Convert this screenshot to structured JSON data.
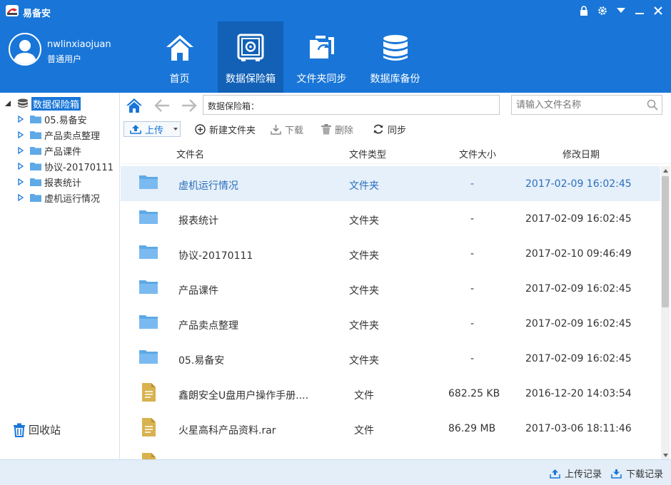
{
  "app": {
    "title": "易备安"
  },
  "user": {
    "name": "nwlinxiaojuan",
    "role": "普通用户"
  },
  "nav": [
    {
      "label": "首页",
      "icon": "home-icon"
    },
    {
      "label": "数据保险箱",
      "icon": "safe-icon",
      "active": true
    },
    {
      "label": "文件夹同步",
      "icon": "folder-sync-icon"
    },
    {
      "label": "数据库备份",
      "icon": "database-icon"
    }
  ],
  "tree": {
    "root": "数据保险箱",
    "children": [
      "05.易备安",
      "产品卖点整理",
      "产品课件",
      "协议-20170111",
      "报表统计",
      "虚机运行情况"
    ]
  },
  "recycle_label": "回收站",
  "address": {
    "path": "数据保险箱：",
    "search_placeholder": "请输入文件名称"
  },
  "toolbar": {
    "upload": "上传",
    "new_folder": "新建文件夹",
    "download": "下载",
    "delete": "删除",
    "sync": "同步"
  },
  "columns": {
    "name": "文件名",
    "type": "文件类型",
    "size": "文件大小",
    "date": "修改日期"
  },
  "files": [
    {
      "name": "虚机运行情况",
      "type": "文件夹",
      "size": "-",
      "date": "2017-02-09 16:02:45",
      "kind": "folder"
    },
    {
      "name": "报表统计",
      "type": "文件夹",
      "size": "-",
      "date": "2017-02-09 16:02:45",
      "kind": "folder"
    },
    {
      "name": "协议-20170111",
      "type": "文件夹",
      "size": "-",
      "date": "2017-02-10 09:46:49",
      "kind": "folder"
    },
    {
      "name": "产品课件",
      "type": "文件夹",
      "size": "-",
      "date": "2017-02-09 16:02:45",
      "kind": "folder"
    },
    {
      "name": "产品卖点整理",
      "type": "文件夹",
      "size": "-",
      "date": "2017-02-09 16:02:45",
      "kind": "folder"
    },
    {
      "name": "05.易备安",
      "type": "文件夹",
      "size": "-",
      "date": "2017-02-09 16:02:45",
      "kind": "folder"
    },
    {
      "name": "鑫朗安全U盘用户操作手册....",
      "type": "文件",
      "size": "682.25 KB",
      "date": "2016-12-20 14:03:54",
      "kind": "file"
    },
    {
      "name": "火星高科产品资料.rar",
      "type": "文件",
      "size": "86.29 MB",
      "date": "2017-03-06 18:11:46",
      "kind": "file"
    },
    {
      "name": "",
      "type": "",
      "size": "",
      "date": "",
      "kind": "file"
    }
  ],
  "footer": {
    "upload_log": "上传记录",
    "download_log": "下载记录"
  },
  "colors": {
    "primary": "#1976d8",
    "nav_active": "#1261b7",
    "folder": "#5ea9e6",
    "file": "#d9b24f"
  }
}
